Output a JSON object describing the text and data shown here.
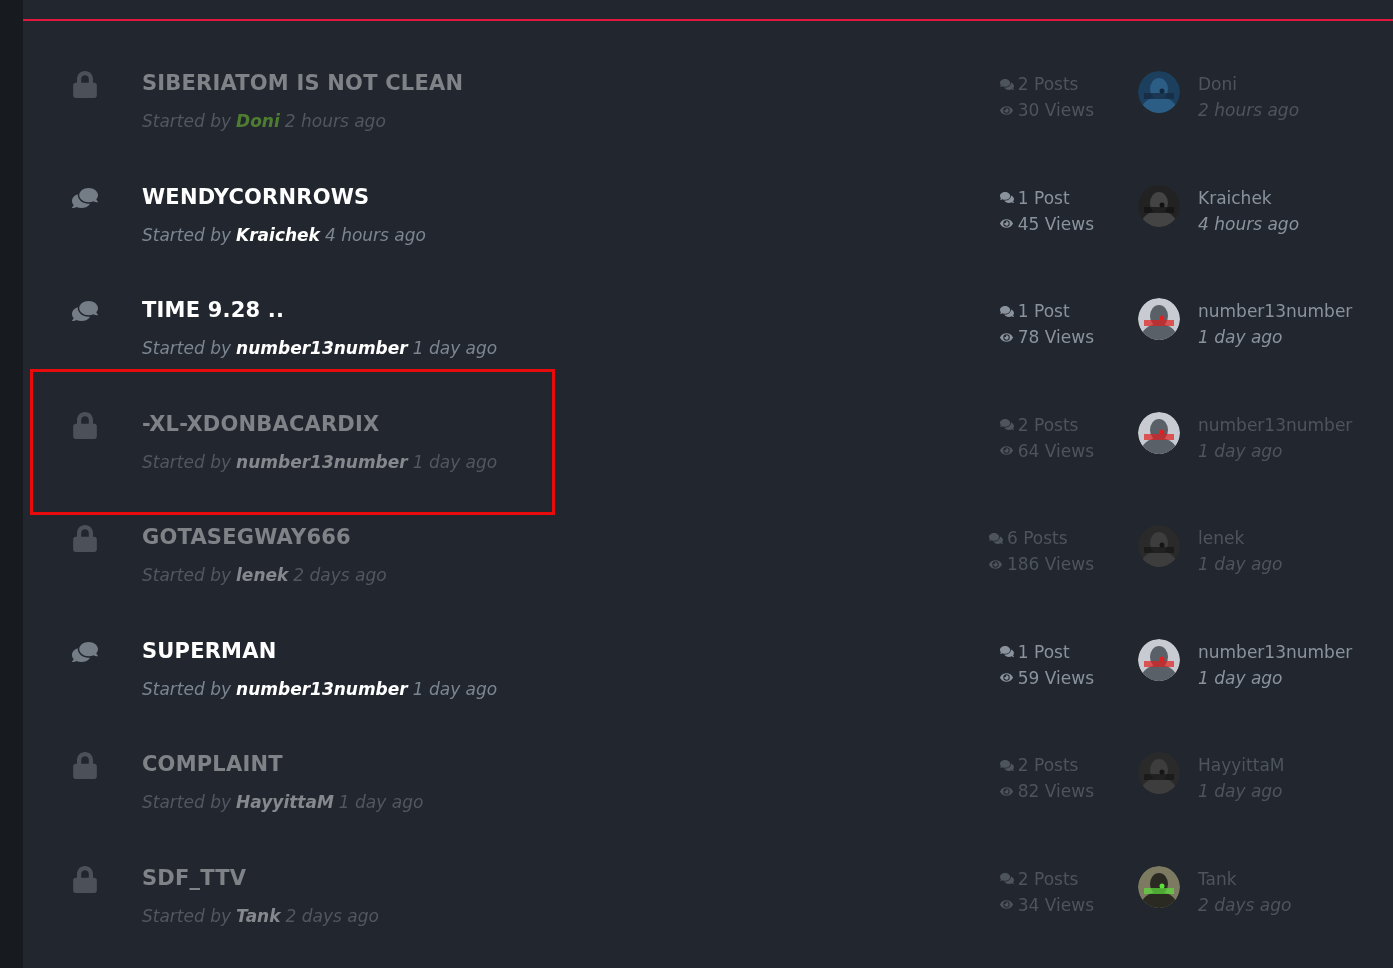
{
  "threads": [
    {
      "title": "SIBERIATOM IS NOT CLEAN",
      "locked": true,
      "highlighted": false,
      "started_by": "Started by",
      "author": "Doni",
      "color": "#4e7d31",
      "started": "2 hours ago",
      "posts": "2 Posts",
      "views": "30 Views",
      "last_poster": "Doni",
      "last_time": "2 hours ago"
    },
    {
      "title": "WENDYCORNROWS",
      "locked": false,
      "highlighted": false,
      "started_by": "Started by",
      "author": "Kraichek",
      "started": "4 hours ago",
      "posts": "1 Post",
      "views": "45 Views",
      "last_poster": "Kraichek",
      "last_time": "4 hours ago"
    },
    {
      "title": "TIME 9.28 ..",
      "locked": false,
      "highlighted": false,
      "started_by": "Started by",
      "author": "number13number",
      "started": "1 day ago",
      "posts": "1 Post",
      "views": "78 Views",
      "last_poster": "number13number",
      "last_time": "1 day ago"
    },
    {
      "title": "-XL-XDONBACARDIX",
      "locked": true,
      "highlighted": true,
      "started_by": "Started by",
      "author": "number13number",
      "started": "1 day ago",
      "posts": "2 Posts",
      "views": "64 Views",
      "last_poster": "number13number",
      "last_time": "1 day ago"
    },
    {
      "title": "GOTASEGWAY666",
      "locked": true,
      "highlighted": false,
      "started_by": "Started by",
      "author": "lenek",
      "started": "2 days ago",
      "posts": "6 Posts",
      "views": "186 Views",
      "last_poster": "lenek",
      "last_time": "1 day ago"
    },
    {
      "title": "SUPERMAN",
      "locked": false,
      "highlighted": false,
      "started_by": "Started by",
      "author": "number13number",
      "started": "1 day ago",
      "posts": "1 Post",
      "views": "59 Views",
      "last_poster": "number13number",
      "last_time": "1 day ago"
    },
    {
      "title": "COMPLAINT",
      "locked": true,
      "highlighted": false,
      "started_by": "Started by",
      "author": "HayyittaM",
      "started": "1 day ago",
      "posts": "2 Posts",
      "views": "82 Views",
      "last_poster": "HayyittaM",
      "last_time": "1 day ago"
    },
    {
      "title": "SDF_TTV",
      "locked": true,
      "highlighted": false,
      "started_by": "Started by",
      "author": "Tank",
      "started": "2 days ago",
      "posts": "2 Posts",
      "views": "34 Views",
      "last_poster": "Tank",
      "last_time": "2 days ago"
    }
  ]
}
